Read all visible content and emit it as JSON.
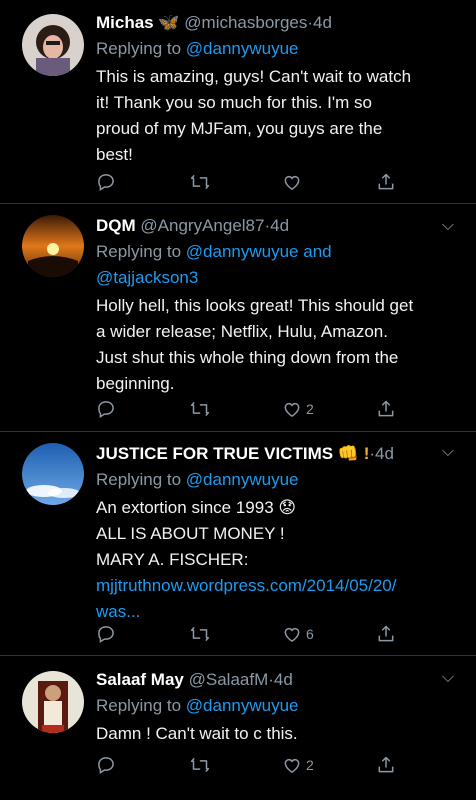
{
  "tweets": [
    {
      "name": "Michas",
      "name_suffix": "🦋",
      "handle": "@michasborges",
      "sep": "·",
      "time": "4d",
      "reply_prefix": "Replying to",
      "reply_to_1": "@dannywuyue",
      "reply_and": "",
      "reply_to_2": "",
      "text_lines": [
        "This is amazing, guys! Can't wait to watch",
        "it! Thank you so much for this. I'm so",
        "proud of my MJFam, you guys are the",
        "best!"
      ],
      "like_count": "",
      "link_lines": []
    },
    {
      "name": "DQM",
      "name_suffix": "",
      "handle": "@AngryAngel87",
      "sep": "·",
      "time": "4d",
      "reply_prefix": "Replying to",
      "reply_to_1": "@dannywuyue",
      "reply_and": " and",
      "reply_to_2": "@tajjackson3",
      "text_lines": [
        "Holly hell, this looks great! This should get",
        "a wider release; Netflix, Hulu, Amazon.",
        "Just shut this whole thing down from the",
        "beginning."
      ],
      "like_count": "2",
      "link_lines": []
    },
    {
      "name": "JUSTICE FOR TRUE VICTIMS",
      "name_suffix": "👊 !",
      "handle": "",
      "sep": "·",
      "time": "4d",
      "reply_prefix": "Replying to",
      "reply_to_1": "@dannywuyue",
      "reply_and": "",
      "reply_to_2": "",
      "text_lines": [
        "An extortion since 1993 😟",
        "ALL IS ABOUT MONEY !",
        "MARY A. FISCHER:"
      ],
      "like_count": "6",
      "link_lines": [
        "mjjtruthnow.wordpress.com/2014/05/20/",
        "was..."
      ]
    },
    {
      "name": "Salaaf May",
      "name_suffix": "",
      "handle": "@SalaafM",
      "sep": "·",
      "time": "4d",
      "reply_prefix": "Replying to",
      "reply_to_1": "@dannywuyue",
      "reply_and": "",
      "reply_to_2": "",
      "text_lines": [
        "Damn ! Can't wait to c this."
      ],
      "like_count": "2",
      "link_lines": []
    }
  ],
  "icons": {
    "reply": "reply-icon",
    "retweet": "retweet-icon",
    "like": "like-icon",
    "share": "share-icon",
    "caret": "chevron-down-icon"
  },
  "caret_glyph": "⌵",
  "colors": {
    "background": "#000000",
    "accent": "#1d9bf0",
    "muted": "#8b98a5",
    "text": "#f1f2f3"
  }
}
